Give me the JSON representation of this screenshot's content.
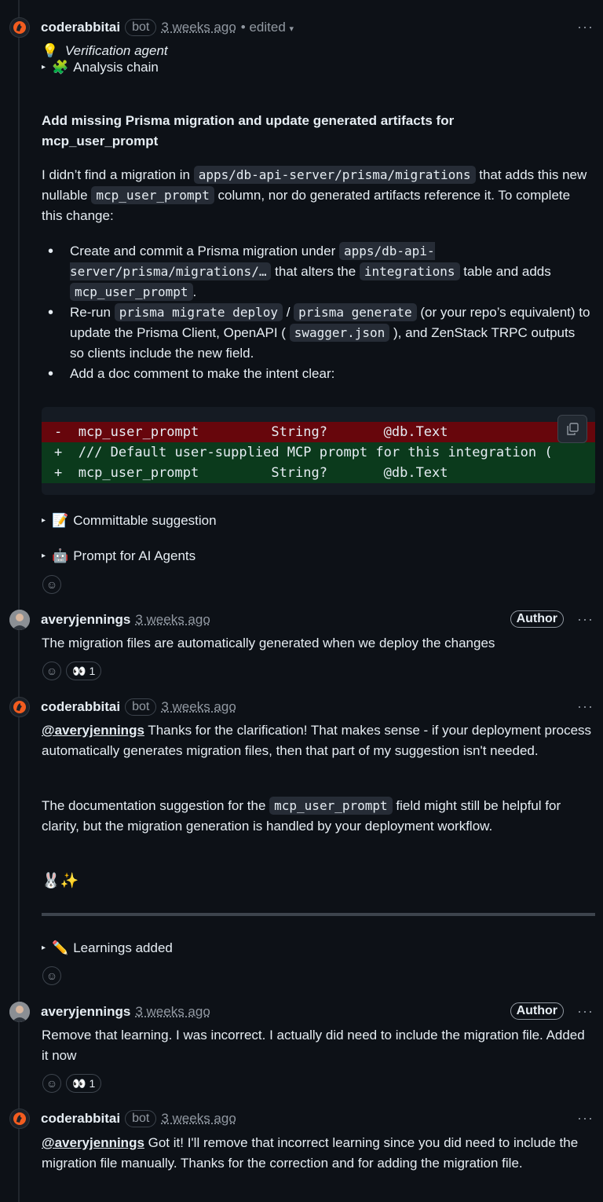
{
  "comments": [
    {
      "author": "coderabbitai",
      "bot_label": "bot",
      "time": "3 weeks ago",
      "edited": "• edited",
      "verification": "Verification agent",
      "analysis_chain": "Analysis chain",
      "heading_line1": "Add missing Prisma migration and update generated artifacts for",
      "heading_line2": "mcp_user_prompt",
      "p1_a": "I didn’t find a migration in ",
      "p1_code1": "apps/db-api-server/prisma/migrations",
      "p1_b": " that adds this new nullable ",
      "p1_code2": "mcp_user_prompt",
      "p1_c": " column, nor do generated artifacts reference it. To complete this change:",
      "b1_a": "Create and commit a Prisma migration under ",
      "b1_code1": "apps/db-api-server/prisma/migrations/…",
      "b1_b": " that alters the ",
      "b1_code2": "integrations",
      "b1_c": " table and adds ",
      "b1_code3": "mcp_user_prompt",
      "b1_d": ".",
      "b2_a": "Re-run ",
      "b2_code1": "prisma migrate deploy",
      "b2_b": " / ",
      "b2_code2": "prisma generate",
      "b2_c": " (or your repo’s equivalent) to update the Prisma Client, OpenAPI ( ",
      "b2_code3": "swagger.json",
      "b2_d": " ), and ZenStack TRPC outputs so clients include the new field.",
      "b3": "Add a doc comment to make the intent clear:",
      "diff": [
        "-  mcp_user_prompt         String?       @db.Text",
        "+  /// Default user-supplied MCP prompt for this integration (",
        "+  mcp_user_prompt         String?       @db.Text"
      ],
      "committable": "Committable suggestion",
      "prompt_ai": "Prompt for AI Agents"
    },
    {
      "author": "averyjennings",
      "time": "3 weeks ago",
      "author_badge": "Author",
      "text": "The migration files are automatically generated when we deploy the changes",
      "reaction_count": "1"
    },
    {
      "author": "coderabbitai",
      "bot_label": "bot",
      "time": "3 weeks ago",
      "mention": "@averyjennings",
      "p1": " Thanks for the clarification! That makes sense - if your deployment process automatically generates migration files, then that part of my suggestion isn't needed.",
      "p2_a": "The documentation suggestion for the ",
      "p2_code": "mcp_user_prompt",
      "p2_b": " field might still be helpful for clarity, but the migration generation is handled by your deployment workflow.",
      "emojis": "🐰✨",
      "learnings": "Learnings added"
    },
    {
      "author": "averyjennings",
      "time": "3 weeks ago",
      "author_badge": "Author",
      "text": "Remove that learning. I was incorrect. I actually did need to include the migration file. Added it now",
      "reaction_count": "1"
    },
    {
      "author": "coderabbitai",
      "bot_label": "bot",
      "time": "3 weeks ago",
      "mention": "@averyjennings",
      "text": " Got it! I'll remove that incorrect learning since you did need to include the migration file manually. Thanks for the correction and for adding the migration file."
    }
  ],
  "icons": {
    "bulb": "💡",
    "puzzle": "🧩",
    "memo": "📝",
    "robot": "🤖",
    "pencil": "✏️",
    "eyes": "👀",
    "smiley": "☺",
    "kebab": "···"
  }
}
